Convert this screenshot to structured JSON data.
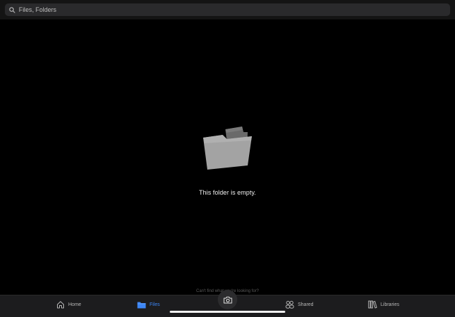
{
  "search": {
    "placeholder": "Files, Folders",
    "icon": "search-icon"
  },
  "empty_state": {
    "message": "This folder is empty.",
    "icon": "folder-icon"
  },
  "help_text": "Can't find what you're looking for?",
  "tabs": [
    {
      "label": "Home",
      "icon": "home-icon",
      "active": false
    },
    {
      "label": "Files",
      "icon": "folder-icon",
      "active": true
    },
    {
      "label": "Shared",
      "icon": "people-icon",
      "active": false
    },
    {
      "label": "Libraries",
      "icon": "library-icon",
      "active": false
    }
  ],
  "camera": {
    "icon": "camera-icon"
  },
  "colors": {
    "background": "#000000",
    "tab_bar": "#1c1c1e",
    "accent": "#3d86f5",
    "search_field": "#2a2a2c"
  }
}
